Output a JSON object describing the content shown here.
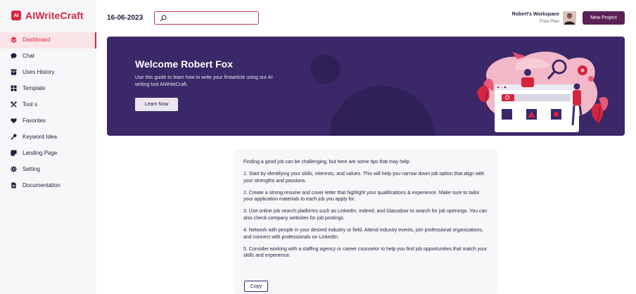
{
  "brand": {
    "mark": "AI",
    "name": "AIWriteCraft"
  },
  "sidebar": {
    "items": [
      {
        "label": "Dashboard",
        "icon": "layers-icon",
        "active": true
      },
      {
        "label": "Chat",
        "icon": "chat-bubble-icon"
      },
      {
        "label": "Uses History",
        "icon": "history-box-icon"
      },
      {
        "label": "Template",
        "icon": "grid-icon"
      },
      {
        "label": "Tool s",
        "icon": "tools-icon"
      },
      {
        "label": "Favorites",
        "icon": "heart-icon"
      },
      {
        "label": "Keyword Idea",
        "icon": "key-icon"
      },
      {
        "label": "Landing Page",
        "icon": "page-icon"
      },
      {
        "label": "Setting",
        "icon": "gear-icon"
      },
      {
        "label": "Documentation",
        "icon": "document-icon"
      }
    ]
  },
  "header": {
    "date": "16-06-2023",
    "search_placeholder": "",
    "workspace_name": "Robert's Workspace",
    "workspace_plan": "Free Plan",
    "new_project_label": "New Project"
  },
  "banner": {
    "title": "Welcome Robert Fox",
    "description": "Use this guide to learn how to write your firstarticle using our AI writing tool AIWriteCraft.",
    "button_label": "Learn Now"
  },
  "tips": {
    "paragraphs": [
      "Finding a good job can be challenging, but here are some tips that may help:",
      "1. Start by identifying your skills, interests, and values. This will help you narrow down job option that align with your strengths and passions.",
      "2. Create a strong resume and cover letter that highlight your qualifications & experience. Make sure to tailor your application materials to each job you apply for.",
      "3. Use online job search platforms such as LinkedIn, Indeed, and Glassdoor to search for job openings. You can also check company websites for job postings.",
      "4. Network with people in your desired industry or field. Attend industry events, join professional organizations, and connect with professionals on LinkedIn.",
      "5. Consider working with a staffing agency or career counselor to help you find job opportunities that match your skills and experience."
    ],
    "copy_label": "Copy"
  },
  "colors": {
    "accent": "#d6243f",
    "banner_bg": "#3a2869",
    "button_primary": "#5b2156"
  }
}
